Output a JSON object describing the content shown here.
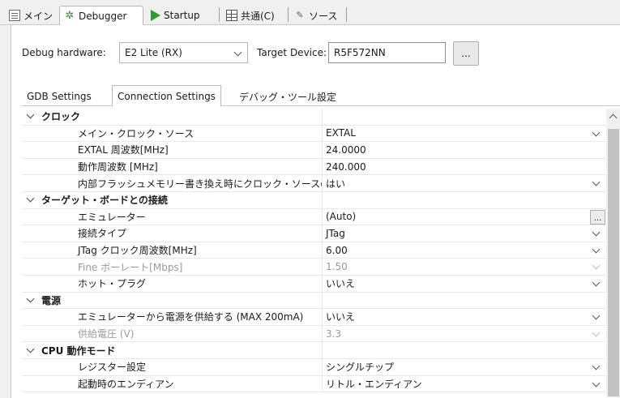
{
  "top_tabs": [
    {
      "label": "メイン",
      "icon": "document-icon"
    },
    {
      "label": "Debugger",
      "icon": "debugger-icon"
    },
    {
      "label": "Startup",
      "icon": "play-icon"
    },
    {
      "label": "共通(C)",
      "icon": "table-icon"
    },
    {
      "label": "ソース",
      "icon": "source-icon"
    }
  ],
  "debug_hardware": {
    "label": "Debug hardware:",
    "value": "E2 Lite (RX)"
  },
  "target_device": {
    "label": "Target Device:",
    "value": "R5F572NN",
    "browse_label": "..."
  },
  "inner_tabs": [
    "GDB Settings",
    "Connection Settings",
    "デバッグ・ツール設定"
  ],
  "grid": {
    "rows": [
      {
        "kind": "cat",
        "name": "クロック",
        "value": ""
      },
      {
        "kind": "item",
        "name": "メイン・クロック・ソース",
        "value": "EXTAL",
        "control": "dropdown"
      },
      {
        "kind": "item",
        "name": "EXTAL 周波数[MHz]",
        "value": "24.0000",
        "control": ""
      },
      {
        "kind": "item",
        "name": "動作周波数 [MHz]",
        "value": "240.000",
        "control": ""
      },
      {
        "kind": "item",
        "name": "内部フラッシュメモリー書き換え時にクロック・ソースの変更",
        "value": "はい",
        "control": "dropdown"
      },
      {
        "kind": "cat",
        "name": "ターゲット・ボードとの接続",
        "value": ""
      },
      {
        "kind": "item",
        "name": "エミュレーター",
        "value": "(Auto)",
        "control": "ellipsis"
      },
      {
        "kind": "item",
        "name": "接続タイプ",
        "value": "JTag",
        "control": "dropdown"
      },
      {
        "kind": "item",
        "name": "JTag クロック周波数[MHz]",
        "value": "6.00",
        "control": "dropdown"
      },
      {
        "kind": "item-disabled",
        "name": "Fine ボーレート[Mbps]",
        "value": "1.50",
        "control": "dropdown"
      },
      {
        "kind": "item",
        "name": "ホット・プラグ",
        "value": "いいえ",
        "control": "dropdown"
      },
      {
        "kind": "cat",
        "name": "電源",
        "value": ""
      },
      {
        "kind": "item",
        "name": "エミュレーターから電源を供給する (MAX 200mA)",
        "value": "いいえ",
        "control": "dropdown"
      },
      {
        "kind": "item-disabled",
        "name": "供給電圧 (V)",
        "value": "3.3",
        "control": "dropdown"
      },
      {
        "kind": "cat",
        "name": "CPU 動作モード",
        "value": ""
      },
      {
        "kind": "item",
        "name": "レジスター設定",
        "value": "シングルチップ",
        "control": "dropdown"
      },
      {
        "kind": "item",
        "name": "起動時のエンディアン",
        "value": "リトル・エンディアン",
        "control": "dropdown"
      }
    ]
  },
  "ellipsis_label": "..."
}
